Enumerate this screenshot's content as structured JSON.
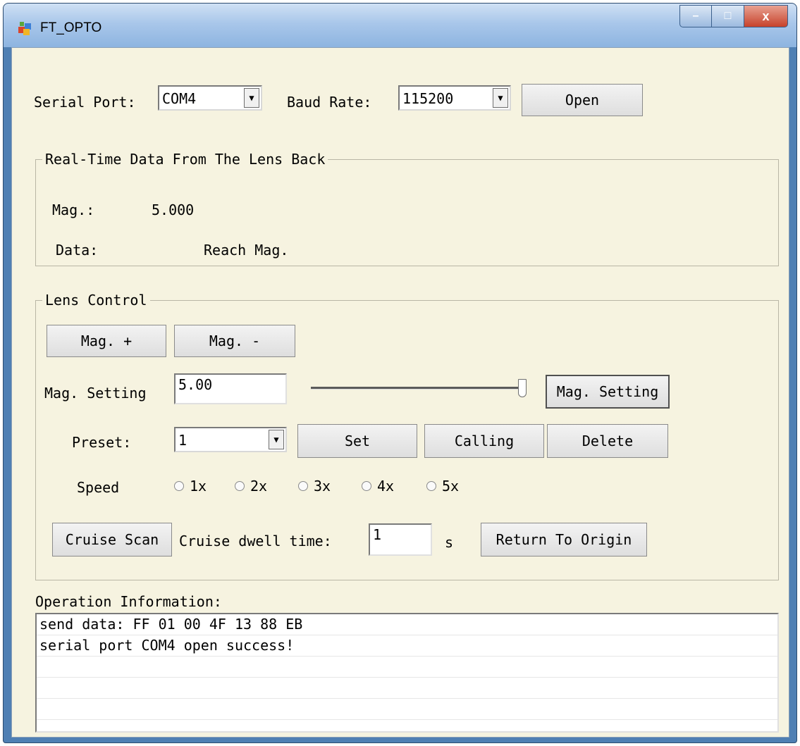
{
  "window": {
    "title": "FT_OPTO",
    "minimize": "–",
    "maximize": "□",
    "close": "x"
  },
  "connection": {
    "serial_port_label": "Serial Port:",
    "serial_port_value": "COM4",
    "baud_rate_label": "Baud Rate:",
    "baud_rate_value": "115200",
    "open_button": "Open"
  },
  "realtime": {
    "title": "Real-Time Data From The Lens Back",
    "mag_label": "Mag.:",
    "mag_value": "5.000",
    "data_label": "Data:",
    "data_value": "Reach Mag."
  },
  "lens_control": {
    "title": "Lens Control",
    "mag_plus": "Mag. +",
    "mag_minus": "Mag. -",
    "mag_setting_label": "Mag. Setting",
    "mag_setting_value": "5.00",
    "mag_setting_button": "Mag. Setting",
    "slider_position": 1.0,
    "preset_label": "Preset:",
    "preset_value": "1",
    "set_button": "Set",
    "calling_button": "Calling",
    "delete_button": "Delete",
    "speed_label": "Speed",
    "speed_options": [
      "1x",
      "2x",
      "3x",
      "4x",
      "5x"
    ],
    "cruise_scan_button": "Cruise Scan",
    "cruise_dwell_label": "Cruise dwell time:",
    "cruise_dwell_value": "1",
    "cruise_dwell_unit": "s",
    "return_origin_button": "Return To Origin"
  },
  "operation": {
    "title": "Operation Information:",
    "lines": [
      "send data: FF 01 00 4F 13 88 EB",
      "serial port COM4 open success!",
      "",
      "",
      ""
    ]
  }
}
